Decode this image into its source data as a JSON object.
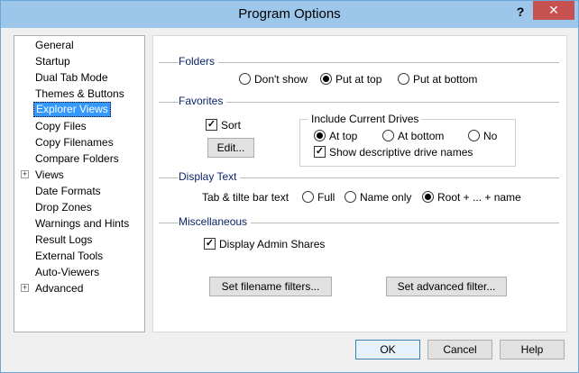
{
  "window": {
    "title": "Program Options",
    "help_glyph": "?",
    "close_glyph": "✕"
  },
  "tree": {
    "items": [
      {
        "label": "General"
      },
      {
        "label": "Startup"
      },
      {
        "label": "Dual Tab Mode"
      },
      {
        "label": "Themes & Buttons"
      },
      {
        "label": "Explorer Views",
        "selected": true
      },
      {
        "label": "Copy Files"
      },
      {
        "label": "Copy Filenames"
      },
      {
        "label": "Compare Folders"
      },
      {
        "label": "Views",
        "expandable": true
      },
      {
        "label": "Date Formats"
      },
      {
        "label": "Drop Zones"
      },
      {
        "label": "Warnings and Hints"
      },
      {
        "label": "Result Logs"
      },
      {
        "label": "External Tools"
      },
      {
        "label": "Auto-Viewers"
      },
      {
        "label": "Advanced",
        "expandable": true
      }
    ],
    "expander_glyph": "+"
  },
  "folders": {
    "heading": "Folders",
    "options": [
      "Don't show",
      "Put at top",
      "Put at bottom"
    ],
    "selected": "Put at top"
  },
  "favorites": {
    "heading": "Favorites",
    "sort_label": "Sort",
    "sort_checked": true,
    "edit_button": "Edit...",
    "drives_group": {
      "title": "Include Current Drives",
      "options": [
        "At top",
        "At bottom",
        "No"
      ],
      "selected": "At top",
      "show_names_label": "Show descriptive drive names",
      "show_names_checked": true
    }
  },
  "display_text": {
    "heading": "Display Text",
    "field_label": "Tab & tilte bar text",
    "options": [
      "Full",
      "Name only",
      "Root + ... + name"
    ],
    "selected": "Root + ... + name"
  },
  "misc": {
    "heading": "Miscellaneous",
    "admin_shares_label": "Display Admin Shares",
    "admin_shares_checked": true,
    "filename_filters_button": "Set filename filters...",
    "advanced_filter_button": "Set advanced filter..."
  },
  "footer": {
    "ok": "OK",
    "cancel": "Cancel",
    "help": "Help"
  },
  "check_glyph": "✓",
  "colors": {
    "titlebar": "#9cc6ea",
    "selection": "#3399ff",
    "close": "#c75050",
    "section_heading": "#0a246a"
  }
}
